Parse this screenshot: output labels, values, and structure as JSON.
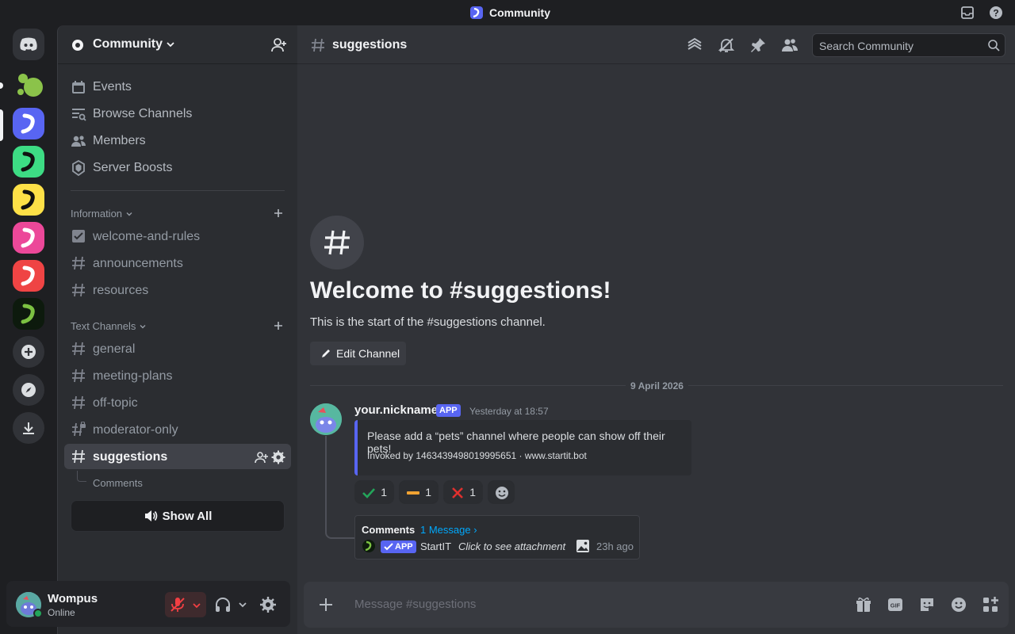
{
  "window": {
    "title": "Community"
  },
  "server": {
    "name": "Community"
  },
  "nav": [
    {
      "label": "Events",
      "icon": "calendar-icon"
    },
    {
      "label": "Browse Channels",
      "icon": "browse-channels-icon"
    },
    {
      "label": "Members",
      "icon": "members-icon"
    },
    {
      "label": "Server Boosts",
      "icon": "boost-icon"
    }
  ],
  "categories": {
    "information": "Information",
    "text_channels": "Text Channels"
  },
  "info_channels": [
    "welcome-and-rules",
    "announcements",
    "resources"
  ],
  "text_channels": [
    "general",
    "meeting-plans",
    "off-topic",
    "moderator-only",
    "suggestions"
  ],
  "thread": {
    "name": "Comments"
  },
  "show_all": "Show All",
  "user": {
    "name": "Wompus",
    "status": "Online"
  },
  "channel": {
    "name": "suggestions"
  },
  "search": {
    "placeholder": "Search Community"
  },
  "welcome": {
    "title": "Welcome to #suggestions!",
    "subtitle": "This is the start of the #suggestions channel.",
    "edit_button": "Edit Channel"
  },
  "date_divider": "9 April 2026",
  "message": {
    "author": "your.nickname",
    "tag": "APP",
    "time": "Yesterday at 18:57",
    "embed_text": "Please add a “pets” channel where people can show off their pets!",
    "embed_footer": "Invoked by 1463439498019995651 · www.startit.bot",
    "reactions": [
      {
        "icon": "check-icon",
        "count": "1"
      },
      {
        "icon": "minus-icon",
        "count": "1"
      },
      {
        "icon": "cross-icon",
        "count": "1"
      }
    ]
  },
  "thread_card": {
    "name": "Comments",
    "count": "1 Message ›",
    "tag": "APP",
    "bot": "StartIT",
    "preview": "Click to see attachment",
    "time": "23h ago"
  },
  "composer": {
    "placeholder": "Message #suggestions"
  },
  "colors": {
    "accent": "#5865f2",
    "online": "#23a55a",
    "link": "#00a8fc"
  }
}
